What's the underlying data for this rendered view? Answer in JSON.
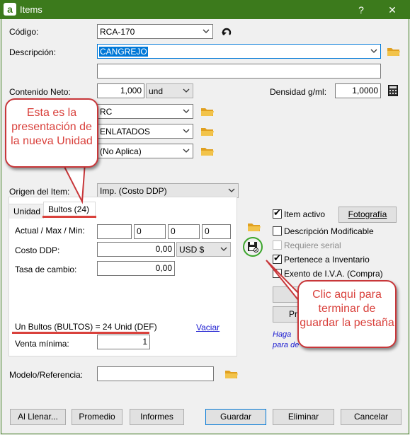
{
  "window": {
    "title": "Items",
    "help_glyph": "?",
    "close_glyph": "✕",
    "app_letter": "a"
  },
  "codigo": {
    "label": "Código:",
    "value": "RCA-170"
  },
  "descripcion": {
    "label": "Descripción:",
    "value": "CANGREJO",
    "value2": ""
  },
  "contenido": {
    "label": "Contenido Neto:",
    "value": "1,000",
    "unit": "und"
  },
  "densidad": {
    "label": "Densidad g/ml:",
    "value": "1,0000"
  },
  "combos": {
    "c1": "RC",
    "c2": "ENLATADOS",
    "c3": "(No Aplica)"
  },
  "origen": {
    "label": "Origen del Item:",
    "value": "Imp. (Costo DDP)"
  },
  "tabs": {
    "t1": "Unidad",
    "t2": "Bultos (24)"
  },
  "actual": {
    "label": "Actual / Max / Min:",
    "v1": "",
    "v2": "0",
    "v3": "0",
    "v4": "0"
  },
  "costo": {
    "label": "Costo DDP:",
    "value": "0,00",
    "currency": "USD $"
  },
  "tasa": {
    "label": "Tasa de cambio:",
    "value": "0,00"
  },
  "bultos_line": "Un Bultos (BULTOS) = 24 Unid (DEF)",
  "vaciar": "Vaciar",
  "venta": {
    "label": "Venta mínima:",
    "value": "1"
  },
  "modelo": {
    "label": "Modelo/Referencia:",
    "value": ""
  },
  "checks": {
    "item_activo": "Item activo",
    "desc_mod": "Descripción Modificable",
    "req_serial": "Requiere serial",
    "pertenece": "Pertenece a Inventario",
    "exento": "Exento de I.V.A. (Compra)"
  },
  "fotografia": "Fotografía",
  "hidden_btn2_label": "Pr",
  "hint": {
    "line1": "Haga",
    "line2": "para de"
  },
  "callouts": {
    "left": "Esta es la presentación de la nueva Unidad",
    "right": "Clic aqui para terminar de guardar la pestaña"
  },
  "buttons": {
    "al_llenar": "Al Llenar...",
    "promedio": "Promedio",
    "informes": "Informes",
    "guardar": "Guardar",
    "eliminar": "Eliminar",
    "cancelar": "Cancelar"
  },
  "colors": {
    "title_bg": "#3c7a1c",
    "callout": "#d9413c",
    "selection": "#0078d7",
    "save_ring": "#3aa52a"
  }
}
